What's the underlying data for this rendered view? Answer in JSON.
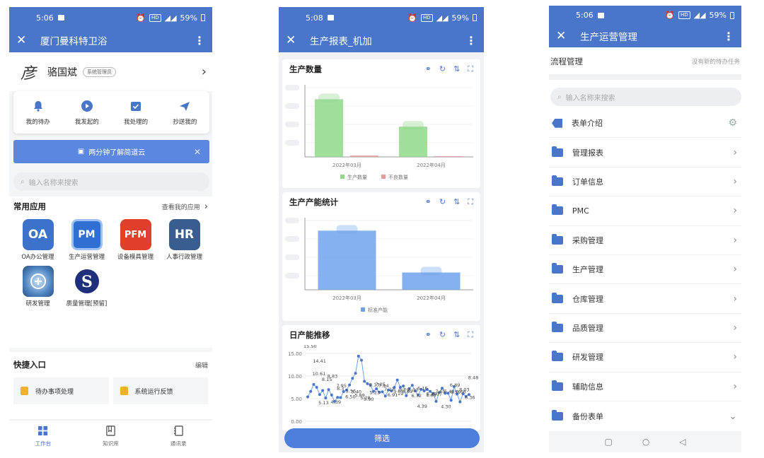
{
  "status_bars": [
    {
      "time": "5:06",
      "battery": "59%"
    },
    {
      "time": "5:08",
      "battery": "59%"
    },
    {
      "time": "5:06",
      "battery": "59%"
    }
  ],
  "colors": {
    "primary": "#4a76c9",
    "bar_green": "#8fd88a",
    "bar_red": "#e89a9a",
    "bar_blue": "#6fa3ec",
    "folder": "#4a76c9"
  },
  "workbench": {
    "title": "厦门曼科特卫浴",
    "user_signature": "彦",
    "user_name": "骆国斌",
    "user_role": "系统管理员",
    "quick_actions": [
      {
        "label": "我的待办",
        "icon": "bell-icon"
      },
      {
        "label": "我发起的",
        "icon": "play-icon"
      },
      {
        "label": "我处理的",
        "icon": "check-icon"
      },
      {
        "label": "抄送我的",
        "icon": "send-icon"
      }
    ],
    "banner": "两分钟了解简道云",
    "search_placeholder": "输入名称来搜索",
    "apps_title": "常用应用",
    "apps_link": "查看我的应用",
    "apps": [
      {
        "label": "OA办公管理",
        "logo": "OA",
        "color": "#3a73c9"
      },
      {
        "label": "生产运营管理",
        "logo": "PM",
        "color": "#2f6fd1"
      },
      {
        "label": "设备模具管理",
        "logo": "PFM",
        "color": "#e0402b"
      },
      {
        "label": "人事行政管理",
        "logo": "HR",
        "color": "#3a5d8f"
      },
      {
        "label": "研发管理",
        "logo": "",
        "color": "#3a6fa8"
      },
      {
        "label": "质量管理[预留]",
        "logo": "S",
        "color": "#ffffff"
      }
    ],
    "entrance_title": "快捷入口",
    "entrance_edit": "编辑",
    "entrances": [
      "待办事项处理",
      "系统运行反馈"
    ],
    "tabs": [
      {
        "label": "工作台",
        "active": true
      },
      {
        "label": "知识库",
        "active": false
      },
      {
        "label": "通讯录",
        "active": false
      }
    ]
  },
  "report": {
    "title": "生产报表_机加",
    "filter_button": "筛选"
  },
  "chart_data": [
    {
      "type": "bar",
      "title": "生产数量",
      "categories": [
        "2022年03月",
        "2022年04月"
      ],
      "series": [
        {
          "name": "生产数量",
          "values": [
            80,
            42
          ]
        },
        {
          "name": "不良数量",
          "values": [
            2,
            1
          ]
        }
      ],
      "ylim": [
        0,
        100
      ],
      "legend": "bottom"
    },
    {
      "type": "bar",
      "title": "生产产能统计",
      "categories": [
        "2022年03月",
        "2022年04月"
      ],
      "series": [
        {
          "name": "标准产能",
          "values": [
            82,
            24
          ]
        }
      ],
      "ylim": [
        0,
        100
      ],
      "legend": "bottom"
    },
    {
      "type": "line",
      "title": "日产能推移",
      "yticks": [
        "0.00",
        "5.00",
        "10.00",
        "15.00"
      ],
      "ylim": [
        0,
        15
      ],
      "values": [
        5.4,
        6.6,
        8.15,
        7.5,
        5.9,
        6.8,
        5.13,
        7.0,
        5.8,
        4.39,
        5.28,
        5.23,
        6.56,
        6.89,
        8.03,
        9.5,
        10.61,
        14.4,
        13.5,
        8.83,
        8.3,
        7.95,
        6.6,
        7.19,
        6.4,
        6.5,
        5.56,
        6.91,
        6.69,
        7.5,
        9.13,
        7.5,
        7.8,
        5.65,
        7.22,
        7.94,
        6.7,
        5.79,
        7.05,
        6.72,
        7.03,
        6.6,
        6.16,
        4.39,
        6.36,
        7.3,
        6.19,
        6.2,
        4.63,
        7.65,
        6.0,
        4.3,
        6.07,
        5.48,
        5.9
      ],
      "labels": [
        "15.50",
        "14.41",
        "10.61",
        "8.15",
        "5.13",
        "4.39",
        "8.83",
        "8.3",
        "7.95",
        "5.56",
        "6.50",
        "5.89",
        "5.40",
        "5.90",
        "5.28",
        "5.23",
        "9.13",
        "7.94",
        "7.05",
        "6.91",
        "7.22",
        "5.65",
        "7.19",
        "6.69",
        "5.79",
        "6.72",
        "7.03",
        "6.16",
        "4.39",
        "6.19",
        "4.63",
        "7.65",
        "6.07",
        "5.48",
        "4.30",
        "6.56",
        "6.89",
        "8.03",
        "6.66",
        "8.48",
        "6.36"
      ]
    }
  ],
  "ops": {
    "title": "生产运营管理",
    "flow_title": "流程管理",
    "flow_status": "没有新的待办任务",
    "search_placeholder": "输入名称来搜索",
    "items": [
      {
        "label": "表单介绍",
        "icon": "tag-icon",
        "trail": "gear"
      },
      {
        "label": "管理报表",
        "icon": "folder-icon",
        "trail": "chevron"
      },
      {
        "label": "订单信息",
        "icon": "folder-icon",
        "trail": "chevron"
      },
      {
        "label": "PMC",
        "icon": "folder-icon",
        "trail": "chevron"
      },
      {
        "label": "采购管理",
        "icon": "folder-icon",
        "trail": "chevron"
      },
      {
        "label": "生产管理",
        "icon": "folder-icon",
        "trail": "chevron"
      },
      {
        "label": "仓库管理",
        "icon": "folder-icon",
        "trail": "chevron"
      },
      {
        "label": "品质管理",
        "icon": "folder-icon",
        "trail": "chevron"
      },
      {
        "label": "研发管理",
        "icon": "folder-icon",
        "trail": "chevron"
      },
      {
        "label": "辅助信息",
        "icon": "folder-icon",
        "trail": "chevron"
      },
      {
        "label": "备份表单",
        "icon": "folder-icon",
        "trail": "chevron-down"
      }
    ]
  }
}
